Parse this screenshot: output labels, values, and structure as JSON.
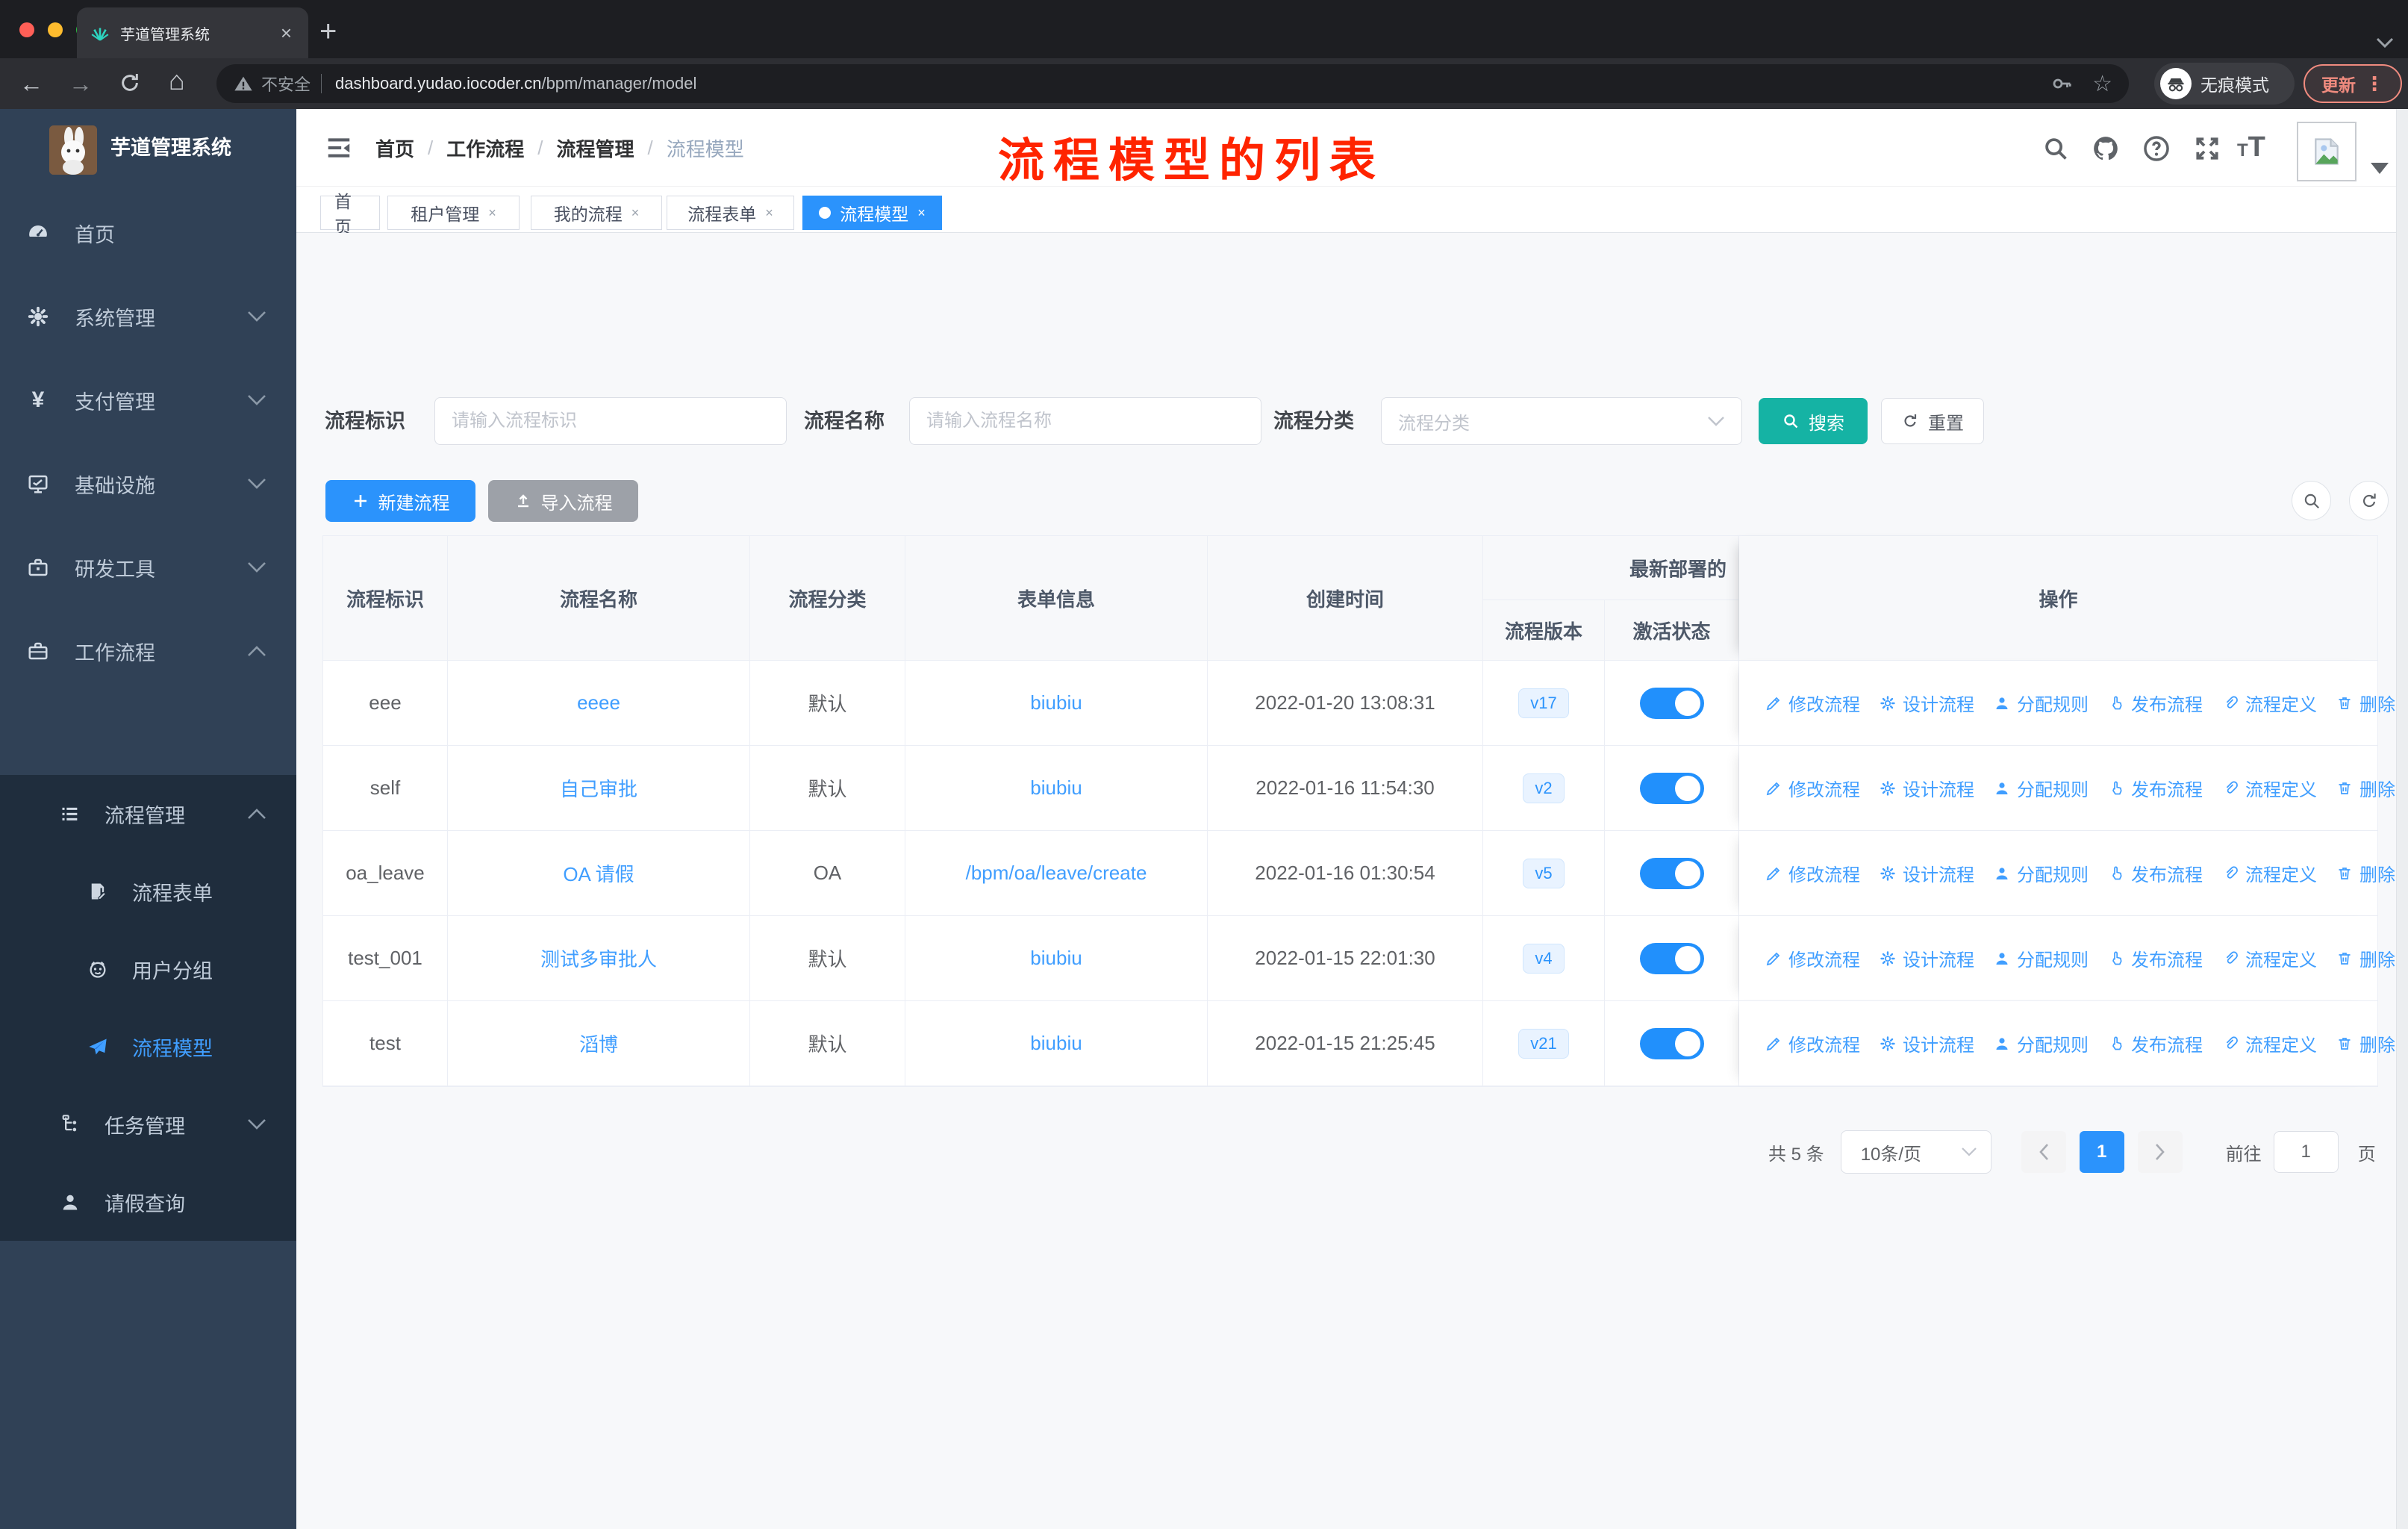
{
  "browser": {
    "tab_title": "芋道管理系统",
    "security_text": "不安全",
    "url_host": "dashboard.yudao.iocoder.cn",
    "url_path": "/bpm/manager/model",
    "incognito_label": "无痕模式",
    "update_label": "更新"
  },
  "sidebar": {
    "app_title": "芋道管理系统",
    "items": [
      {
        "label": "首页"
      },
      {
        "label": "系统管理"
      },
      {
        "label": "支付管理"
      },
      {
        "label": "基础设施"
      },
      {
        "label": "研发工具"
      },
      {
        "label": "工作流程"
      }
    ],
    "workflow_children": [
      {
        "label": "流程管理"
      },
      {
        "label": "流程表单"
      },
      {
        "label": "用户分组"
      },
      {
        "label": "流程模型"
      },
      {
        "label": "任务管理"
      },
      {
        "label": "请假查询"
      }
    ]
  },
  "header": {
    "breadcrumb": [
      "首页",
      "工作流程",
      "流程管理",
      "流程模型"
    ],
    "annotation": "流程模型的列表"
  },
  "tags": [
    {
      "label": "首页"
    },
    {
      "label": "租户管理"
    },
    {
      "label": "我的流程"
    },
    {
      "label": "流程表单"
    },
    {
      "label": "流程模型"
    }
  ],
  "filters": {
    "key_label": "流程标识",
    "key_placeholder": "请输入流程标识",
    "name_label": "流程名称",
    "name_placeholder": "请输入流程名称",
    "category_label": "流程分类",
    "category_placeholder": "流程分类",
    "search_label": "搜索",
    "reset_label": "重置"
  },
  "toolbar": {
    "create_label": "新建流程",
    "import_label": "导入流程"
  },
  "table": {
    "columns": [
      "流程标识",
      "流程名称",
      "流程分类",
      "表单信息",
      "创建时间"
    ],
    "deploy_group_label": "最新部署的",
    "version_label": "流程版本",
    "active_label": "激活状态",
    "actions_label": "操作",
    "action_items": [
      "修改流程",
      "设计流程",
      "分配规则",
      "发布流程",
      "流程定义",
      "删除"
    ],
    "rows": [
      {
        "key": "eee",
        "name": "eeee",
        "category": "默认",
        "form": "biubiu",
        "created": "2022-01-20 13:08:31",
        "version": "v17",
        "active": true
      },
      {
        "key": "self",
        "name": "自己审批",
        "category": "默认",
        "form": "biubiu",
        "created": "2022-01-16 11:54:30",
        "version": "v2",
        "active": true
      },
      {
        "key": "oa_leave",
        "name": "OA 请假",
        "category": "OA",
        "form": "/bpm/oa/leave/create",
        "created": "2022-01-16 01:30:54",
        "version": "v5",
        "active": true
      },
      {
        "key": "test_001",
        "name": "测试多审批人",
        "category": "默认",
        "form": "biubiu",
        "created": "2022-01-15 22:01:30",
        "version": "v4",
        "active": true
      },
      {
        "key": "test",
        "name": "滔博",
        "category": "默认",
        "form": "biubiu",
        "created": "2022-01-15 21:25:45",
        "version": "v21",
        "active": true
      }
    ]
  },
  "pagination": {
    "total": "共 5 条",
    "page_size": "10条/页",
    "page": "1",
    "goto_label": "前往",
    "goto_value": "1",
    "unit_label": "页"
  },
  "colors": {
    "primary": "#2b93fc",
    "link": "#409eff",
    "search_button": "#15b3a4",
    "annotation_red": "#ff2400",
    "sidebar_bg": "#304156",
    "submenu_bg": "#1f2d3d"
  }
}
